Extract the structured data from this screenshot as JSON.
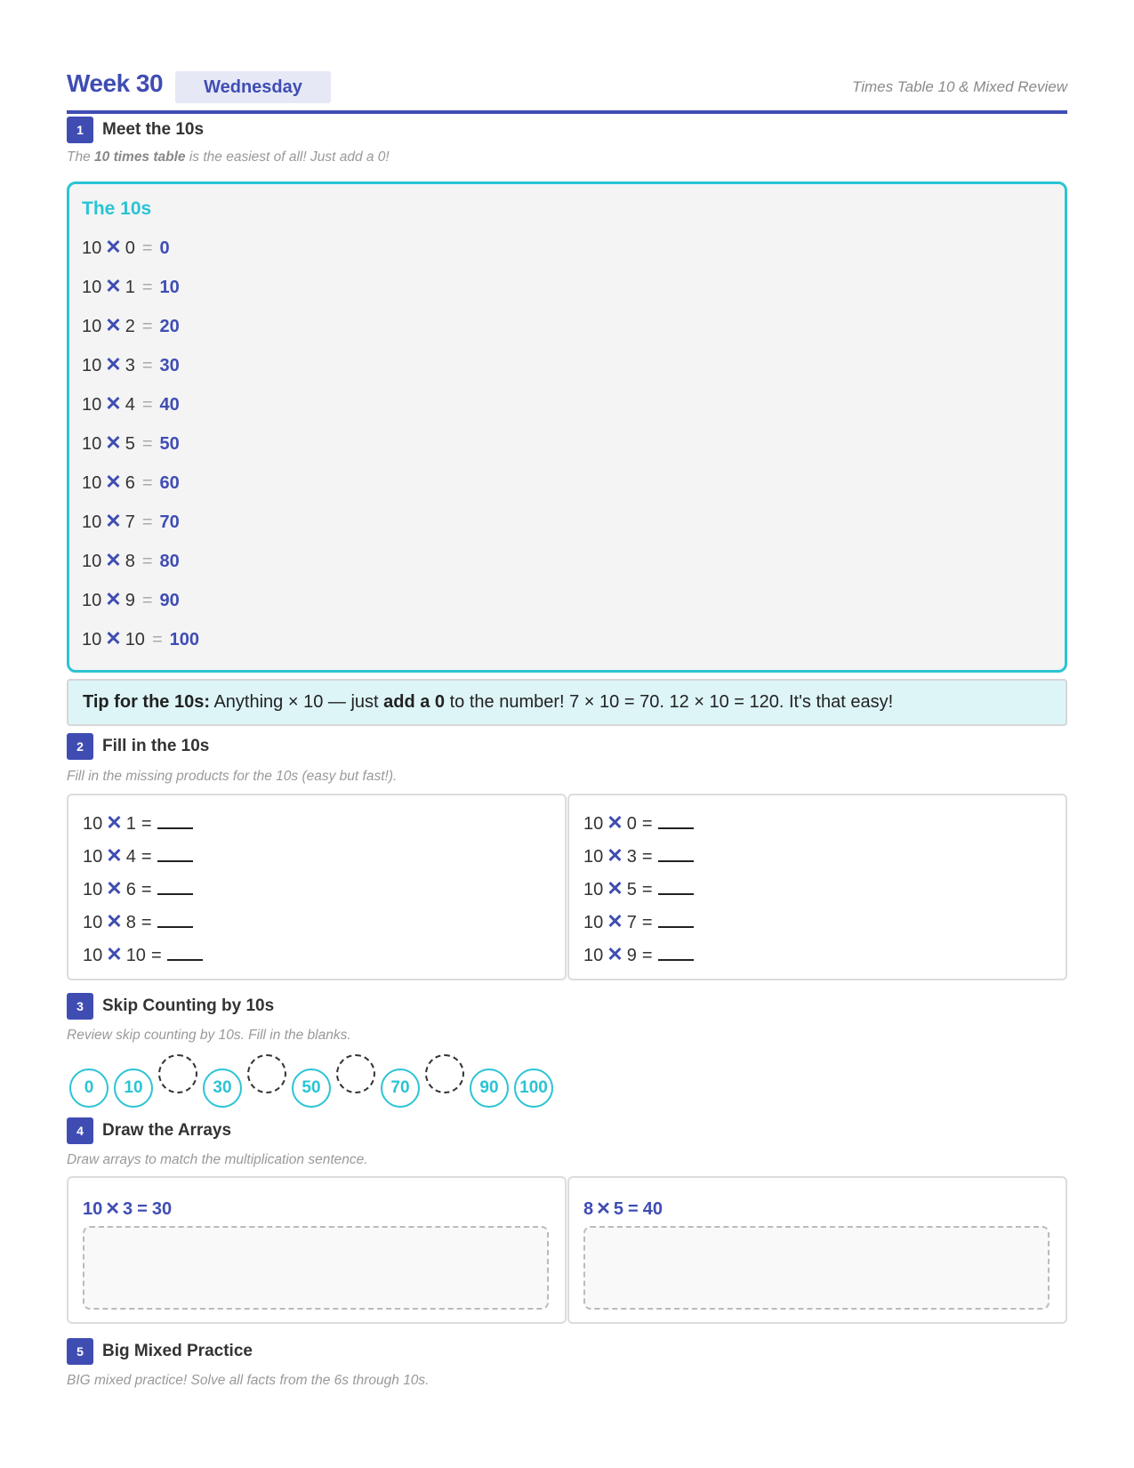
{
  "header": {
    "week": "Week 30",
    "day": "Wednesday",
    "subtitle": "Times Table 10 & Mixed Review"
  },
  "sections": [
    {
      "num": "1",
      "title": "Meet the 10s",
      "desc_pre": "The ",
      "desc_bold": "10 times table",
      "desc_post": " is the easiest of all! Just add a 0!"
    },
    {
      "num": "2",
      "title": "Fill in the 10s",
      "desc": "Fill in the missing products for the 10s (easy but fast!)."
    },
    {
      "num": "3",
      "title": "Skip Counting by 10s",
      "desc": "Review skip counting by 10s. Fill in the blanks."
    },
    {
      "num": "4",
      "title": "Draw the Arrays",
      "desc": "Draw arrays to match the multiplication sentence."
    },
    {
      "num": "5",
      "title": "Big Mixed Practice",
      "desc": "BIG mixed practice! Solve all facts from the 6s through 10s."
    }
  ],
  "tens_box": {
    "title": "The 10s",
    "facts": [
      {
        "a": "10",
        "b": "0",
        "ans": "0"
      },
      {
        "a": "10",
        "b": "1",
        "ans": "10"
      },
      {
        "a": "10",
        "b": "2",
        "ans": "20"
      },
      {
        "a": "10",
        "b": "3",
        "ans": "30"
      },
      {
        "a": "10",
        "b": "4",
        "ans": "40"
      },
      {
        "a": "10",
        "b": "5",
        "ans": "50"
      },
      {
        "a": "10",
        "b": "6",
        "ans": "60"
      },
      {
        "a": "10",
        "b": "7",
        "ans": "70"
      },
      {
        "a": "10",
        "b": "8",
        "ans": "80"
      },
      {
        "a": "10",
        "b": "9",
        "ans": "90"
      },
      {
        "a": "10",
        "b": "10",
        "ans": "100"
      }
    ]
  },
  "tip": {
    "label": "Tip for the 10s:",
    "text1": " Anything × 10 — just ",
    "bold": "add a 0",
    "text2": " to the number! 7 × 10 = 70. 12 × 10 = 120. It's that easy!"
  },
  "fill": {
    "left": [
      {
        "a": "10",
        "b": "1"
      },
      {
        "a": "10",
        "b": "4"
      },
      {
        "a": "10",
        "b": "6"
      },
      {
        "a": "10",
        "b": "8"
      },
      {
        "a": "10",
        "b": "10"
      }
    ],
    "right": [
      {
        "a": "10",
        "b": "0"
      },
      {
        "a": "10",
        "b": "3"
      },
      {
        "a": "10",
        "b": "5"
      },
      {
        "a": "10",
        "b": "7"
      },
      {
        "a": "10",
        "b": "9"
      }
    ]
  },
  "skip_counting": [
    "0",
    "10",
    "",
    "30",
    "",
    "50",
    "",
    "70",
    "",
    "90",
    "100"
  ],
  "arrays": [
    {
      "a": "10",
      "b": "3",
      "result": "30"
    },
    {
      "a": "8",
      "b": "5",
      "result": "40"
    }
  ],
  "symbols": {
    "times": "✕",
    "equals": "="
  },
  "colors": {
    "primary": "#3f4db3",
    "accent": "#2ac4d4",
    "tip_bg": "#def5f8"
  }
}
